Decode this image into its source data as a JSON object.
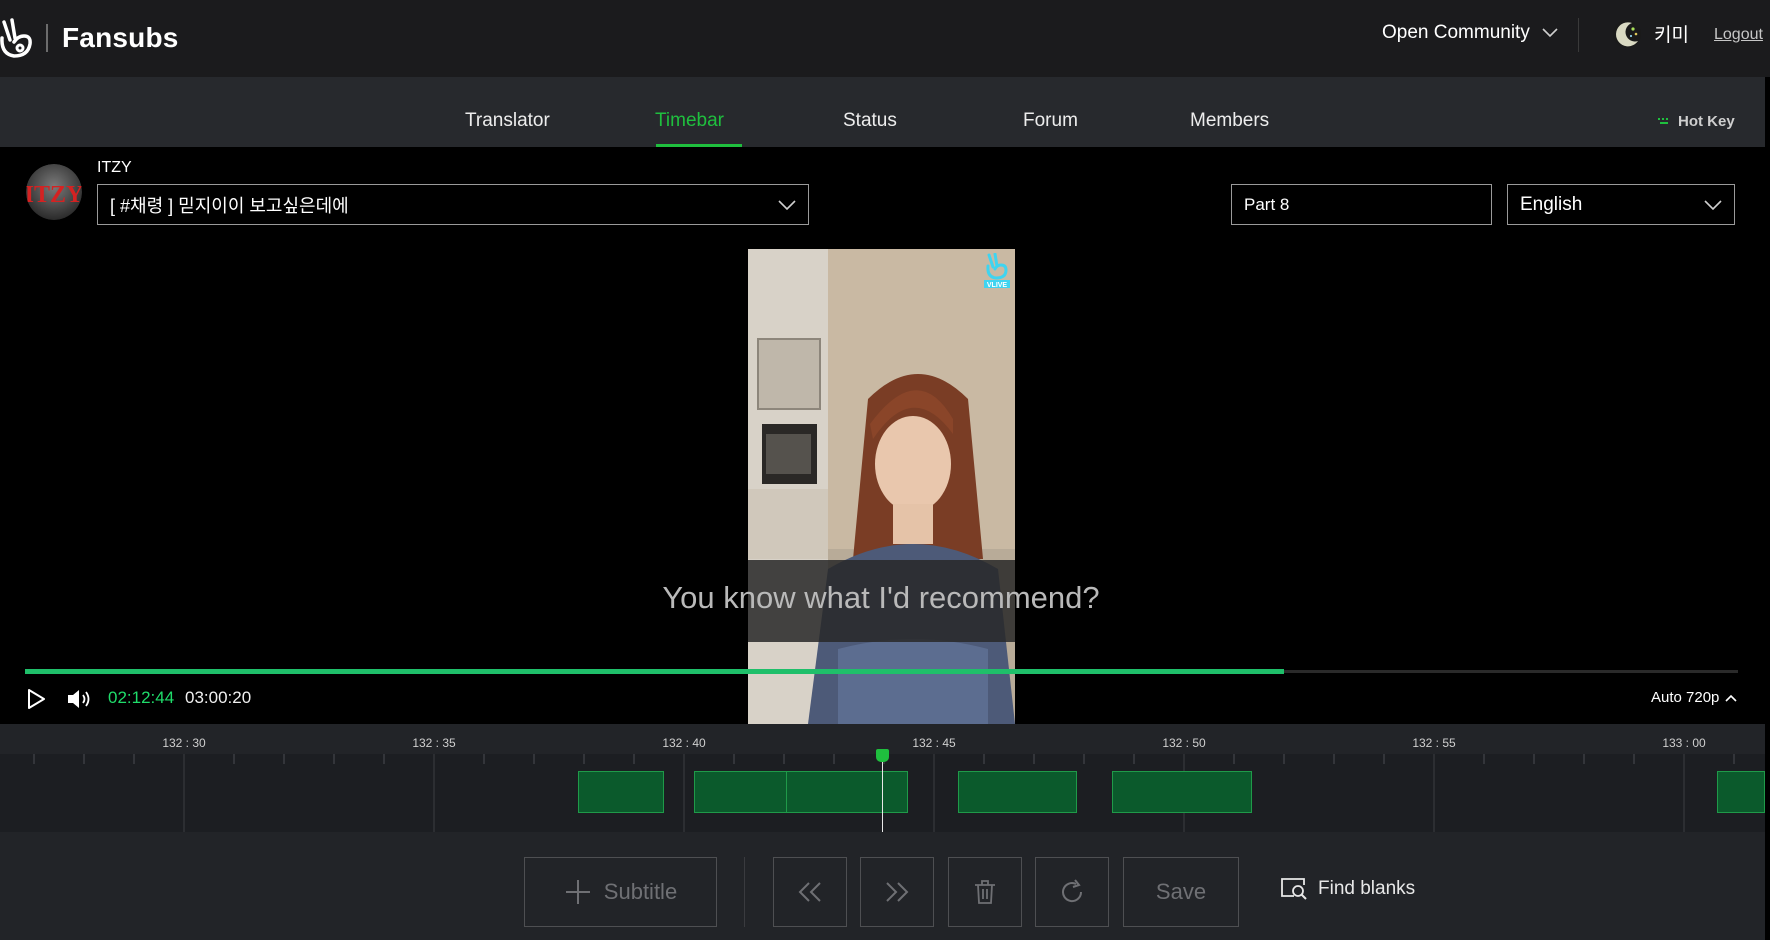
{
  "header": {
    "brand": "Fansubs",
    "community_label": "Open Community",
    "username": "키미",
    "logout_label": "Logout"
  },
  "nav": {
    "tabs": [
      {
        "label": "Translator",
        "active": false
      },
      {
        "label": "Timebar",
        "active": true
      },
      {
        "label": "Status",
        "active": false
      },
      {
        "label": "Forum",
        "active": false
      },
      {
        "label": "Members",
        "active": false
      }
    ],
    "hotkey_label": "Hot Key"
  },
  "video_info": {
    "channel_name": "ITZY",
    "channel_logo_text": "ITZY",
    "selected_video": "[ #채령 ] 믿지이이 보고싶은데에",
    "part_value": "Part 8",
    "language": "English"
  },
  "player": {
    "watermark": "VLIVE",
    "subtitle_text": "You know what I'd recommend?",
    "current_time": "02:12:44",
    "duration": "03:00:20",
    "progress": 0.735,
    "quality_label": "Auto 720p"
  },
  "timeline": {
    "tick_labels": [
      "132 : 30",
      "132 : 35",
      "132 : 40",
      "132 : 45",
      "132 : 50",
      "132 : 55",
      "133 : 00"
    ]
  },
  "toolbar": {
    "subtitle_label": "Subtitle",
    "save_label": "Save",
    "find_blanks_label": "Find blanks"
  },
  "colors": {
    "accent": "#1fbf3e",
    "progress": "#1fbf6a",
    "segment_fill": "#0b5a2c",
    "segment_border": "#1f9a49"
  }
}
